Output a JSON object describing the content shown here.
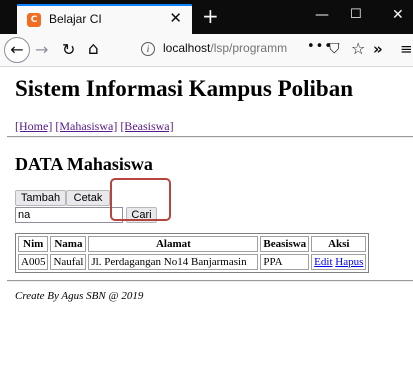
{
  "browser": {
    "tab_title": "Belajar CI",
    "tab_favicon_label": "C",
    "url_host": "localhost",
    "url_path": "/lsp/programm",
    "url_more": "•••"
  },
  "page": {
    "title": "Sistem Informasi Kampus Poliban",
    "nav": {
      "home": "[Home]",
      "mahasiswa": "[Mahasiswa]",
      "beasiswa": "[Beasiswa]"
    },
    "section_title": "DATA Mahasiswa",
    "buttons": {
      "tambah": "Tambah",
      "cetak": "Cetak",
      "cari": "Cari"
    },
    "search": {
      "value": "na"
    },
    "table": {
      "headers": [
        "Nim",
        "Nama",
        "Alamat",
        "Beasiswa",
        "Aksi"
      ],
      "rows": [
        {
          "nim": "A005",
          "nama": "Naufal",
          "alamat": "Jl. Perdagangan No14 Banjarmasin",
          "beasiswa": "PPA",
          "edit": "Edit",
          "hapus": "Hapus"
        }
      ]
    },
    "footer": "Create By Agus SBN @ 2019"
  }
}
